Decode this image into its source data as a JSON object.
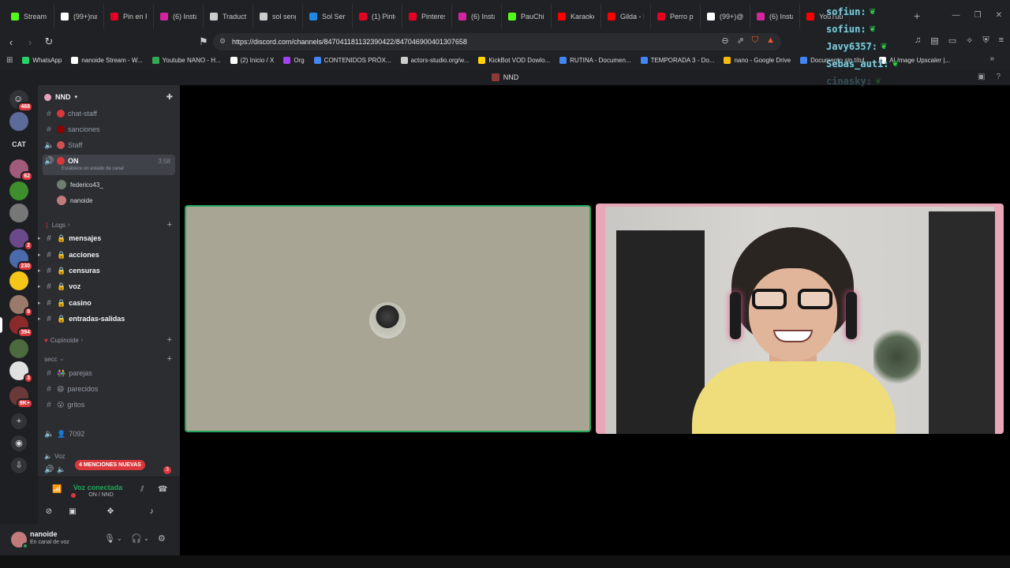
{
  "browser": {
    "tabs": [
      {
        "title": "Stream",
        "color": "#53fc18"
      },
      {
        "title": "(99+)na",
        "color": "#ffffff"
      },
      {
        "title": "Pin en R",
        "color": "#e60023"
      },
      {
        "title": "(6) Insta",
        "color": "#d6249f"
      },
      {
        "title": "Traducto",
        "color": "#cccccc"
      },
      {
        "title": "sol seng",
        "color": "#cccccc"
      },
      {
        "title": "Sol Seng",
        "color": "#1e88e5"
      },
      {
        "title": "(1) Pinte",
        "color": "#e60023"
      },
      {
        "title": "Pinterest",
        "color": "#e60023"
      },
      {
        "title": "(6) Insta",
        "color": "#d6249f"
      },
      {
        "title": "PauChik",
        "color": "#53fc18"
      },
      {
        "title": "Karaoke",
        "color": "#ff0000"
      },
      {
        "title": "Gilda - I",
        "color": "#ff0000"
      },
      {
        "title": "Perro pe",
        "color": "#e60023"
      },
      {
        "title": "(99+)@",
        "color": "#ffffff"
      },
      {
        "title": "(6) Insta",
        "color": "#d6249f"
      },
      {
        "title": "YouTube",
        "color": "#ff0000"
      }
    ],
    "url": "https://discord.com/channels/847041181132390422/847046900401307658",
    "bookmarks": [
      {
        "label": "WhatsApp",
        "color": "#25d366"
      },
      {
        "label": "nanoide Stream - W...",
        "color": "#ffffff"
      },
      {
        "label": "Youtube NANO - H...",
        "color": "#34a853"
      },
      {
        "label": "(2) Inicio / X",
        "color": "#ffffff"
      },
      {
        "label": "Org",
        "color": "#a142f4"
      },
      {
        "label": "CONTENIDOS PRÓX...",
        "color": "#4285f4"
      },
      {
        "label": "actors-studio.org/w...",
        "color": "#cccccc"
      },
      {
        "label": "KickBot VOD Dowlo...",
        "color": "#ffd400"
      },
      {
        "label": "RUTINA - Documen...",
        "color": "#4285f4"
      },
      {
        "label": "TEMPORADA 3 - Do...",
        "color": "#4285f4"
      },
      {
        "label": "nano - Google Drive",
        "color": "#fbbc04"
      },
      {
        "label": "Documento sin títul...",
        "color": "#4285f4"
      },
      {
        "label": "AI Image Upscaler |...",
        "color": "#ffffff"
      }
    ]
  },
  "discord": {
    "window_title": "NND",
    "server_name": "NND",
    "rail": {
      "mentions_top": "468",
      "cat_label": "CAT",
      "badges": [
        "62",
        "2",
        "230",
        "9",
        "394",
        "3",
        "9K+"
      ]
    },
    "channels_top": [
      {
        "name": "chat-staff",
        "emoji_color": "#da373c"
      },
      {
        "name": "sanciones",
        "emoji_color": "#8b0000"
      },
      {
        "name": "Staff",
        "emoji_color": "#d05050"
      }
    ],
    "active_channel": {
      "name": "ON",
      "status": "Establece un estado de canal",
      "timer": "3:58"
    },
    "voice_users": [
      {
        "name": "federico43_",
        "color": "#6f7f6f"
      },
      {
        "name": "nanoide",
        "color": "#c27b7b"
      }
    ],
    "category_logs": "Logs",
    "log_channels": [
      "mensajes",
      "acciones",
      "censuras",
      "voz",
      "casino",
      "entradas-salidas"
    ],
    "category_cupinoide": "Cupinoide",
    "category_secc": "secc",
    "secc_channels": [
      {
        "name": "parejas",
        "emoji": "👫"
      },
      {
        "name": "parecidos",
        "emoji": "😄"
      },
      {
        "name": "gritos",
        "emoji": "😮"
      }
    ],
    "voice_count_channel": "7092",
    "category_voz": "Voz",
    "mentions_new": "4 MENCIONES NUEVAS",
    "mentions_count": "3",
    "voice_panel": {
      "title": "Voz conectada",
      "subtitle": "ON / NND"
    },
    "user": {
      "name": "nanoide",
      "status": "En canal de voz"
    }
  },
  "overlay_chat": [
    {
      "user": "sofiun:"
    },
    {
      "user": "sofiun:"
    },
    {
      "user": "Javy6357:"
    },
    {
      "user": "Sebas_auti:"
    },
    {
      "user": "cinasky:"
    }
  ]
}
